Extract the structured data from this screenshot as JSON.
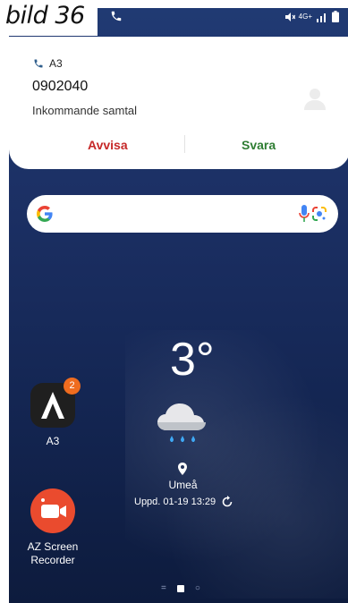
{
  "overlay_label": "bild 36",
  "status_bar": {
    "network": "4G+"
  },
  "notification": {
    "app_name": "A3",
    "caller_number": "0902040",
    "call_status": "Inkommande samtal",
    "decline_label": "Avvisa",
    "answer_label": "Svara"
  },
  "weather": {
    "temperature": "3°",
    "city": "Umeå",
    "updated": "Uppd. 01-19 13:29"
  },
  "apps": [
    {
      "label": "A3",
      "badge": "2"
    },
    {
      "label": "AZ Screen Recorder"
    }
  ],
  "colors": {
    "decline": "#c62828",
    "answer": "#2e7d32",
    "badge": "#ef6c1f",
    "az_icon": "#ea4b2e"
  }
}
